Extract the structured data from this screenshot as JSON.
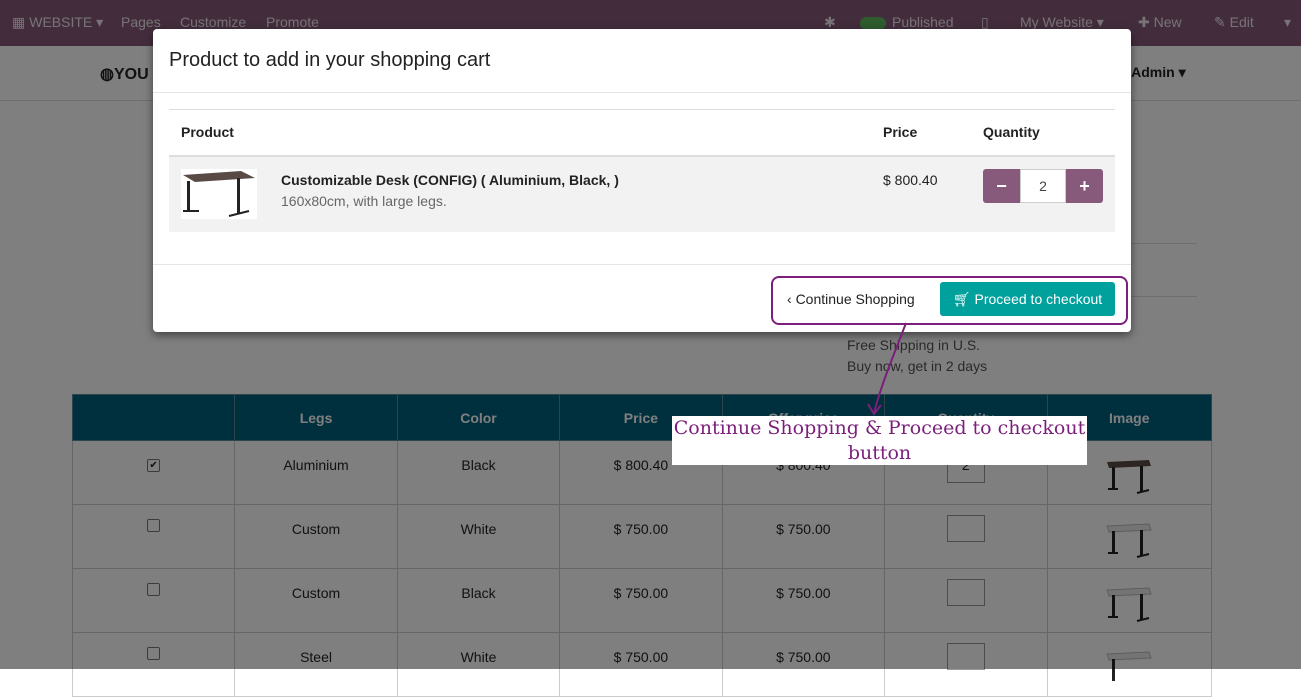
{
  "navbar": {
    "website_menu": "WEBSITE",
    "pages": "Pages",
    "customize": "Customize",
    "promote": "Promote",
    "published": "Published",
    "my_website": "My Website",
    "new": "New",
    "edit": "Edit"
  },
  "site": {
    "logo_text": "YOU",
    "user_text": "ll Admin",
    "shipping_line1": "Free Shipping in U.S.",
    "shipping_line2": "Buy now, get in 2 days"
  },
  "variants": {
    "headers": [
      "",
      "Legs",
      "Color",
      "Price",
      "Offer price",
      "Quantity",
      "Image"
    ],
    "rows": [
      {
        "checked": true,
        "legs": "Aluminium",
        "color": "Black",
        "price": "$ 800.40",
        "offer": "$ 800.40",
        "qty": "2"
      },
      {
        "checked": false,
        "legs": "Custom",
        "color": "White",
        "price": "$ 750.00",
        "offer": "$ 750.00",
        "qty": ""
      },
      {
        "checked": false,
        "legs": "Custom",
        "color": "Black",
        "price": "$ 750.00",
        "offer": "$ 750.00",
        "qty": ""
      },
      {
        "checked": false,
        "legs": "Steel",
        "color": "White",
        "price": "$ 750.00",
        "offer": "$ 750.00",
        "qty": ""
      }
    ]
  },
  "modal": {
    "title": "Product to add in your shopping cart",
    "col_product": "Product",
    "col_price": "Price",
    "col_quantity": "Quantity",
    "product_name": "Customizable Desk (CONFIG) ( Aluminium, Black, )",
    "product_desc": "160x80cm, with large legs.",
    "product_price": "$ 800.40",
    "quantity": "2",
    "continue_label": "Continue Shopping",
    "checkout_label": "Proceed to checkout"
  },
  "annotation": {
    "text": "Continue Shopping & Proceed to checkout button",
    "color": "#7b1f7b"
  }
}
